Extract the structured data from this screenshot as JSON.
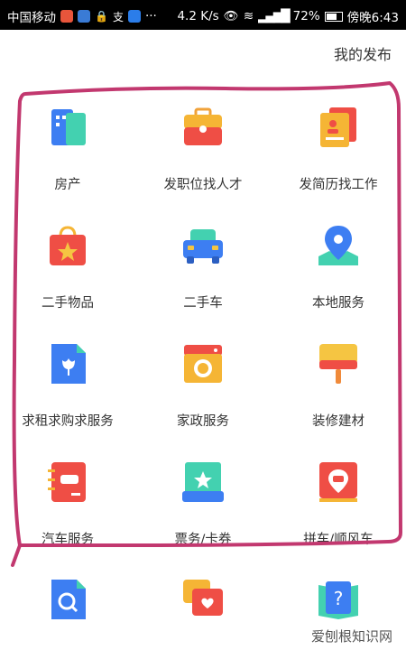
{
  "status_bar": {
    "carrier": "中国移动",
    "speed": "4.2 K/s",
    "battery": "72%",
    "time": "傍晚6:43",
    "more": "···"
  },
  "header": {
    "my_post": "我的发布"
  },
  "categories": [
    {
      "label": "房产",
      "icon": "building-icon"
    },
    {
      "label": "发职位找人才",
      "icon": "briefcase-icon"
    },
    {
      "label": "发简历找工作",
      "icon": "resume-icon"
    },
    {
      "label": "二手物品",
      "icon": "shopping-bag-icon"
    },
    {
      "label": "二手车",
      "icon": "car-icon"
    },
    {
      "label": "本地服务",
      "icon": "location-pin-icon"
    },
    {
      "label": "求租求购求服务",
      "icon": "document-tulip-icon"
    },
    {
      "label": "家政服务",
      "icon": "washing-machine-icon"
    },
    {
      "label": "装修建材",
      "icon": "paint-roller-icon"
    },
    {
      "label": "汽车服务",
      "icon": "car-notebook-icon"
    },
    {
      "label": "票务/卡券",
      "icon": "ticket-icon"
    },
    {
      "label": "拼车/顺风车",
      "icon": "carpool-icon"
    },
    {
      "label": "",
      "icon": "document-search-icon"
    },
    {
      "label": "",
      "icon": "chat-heart-icon"
    },
    {
      "label": "",
      "icon": "book-question-icon"
    }
  ],
  "watermark": "爱刨根知识网",
  "colors": {
    "highlight": "#c2386f"
  }
}
